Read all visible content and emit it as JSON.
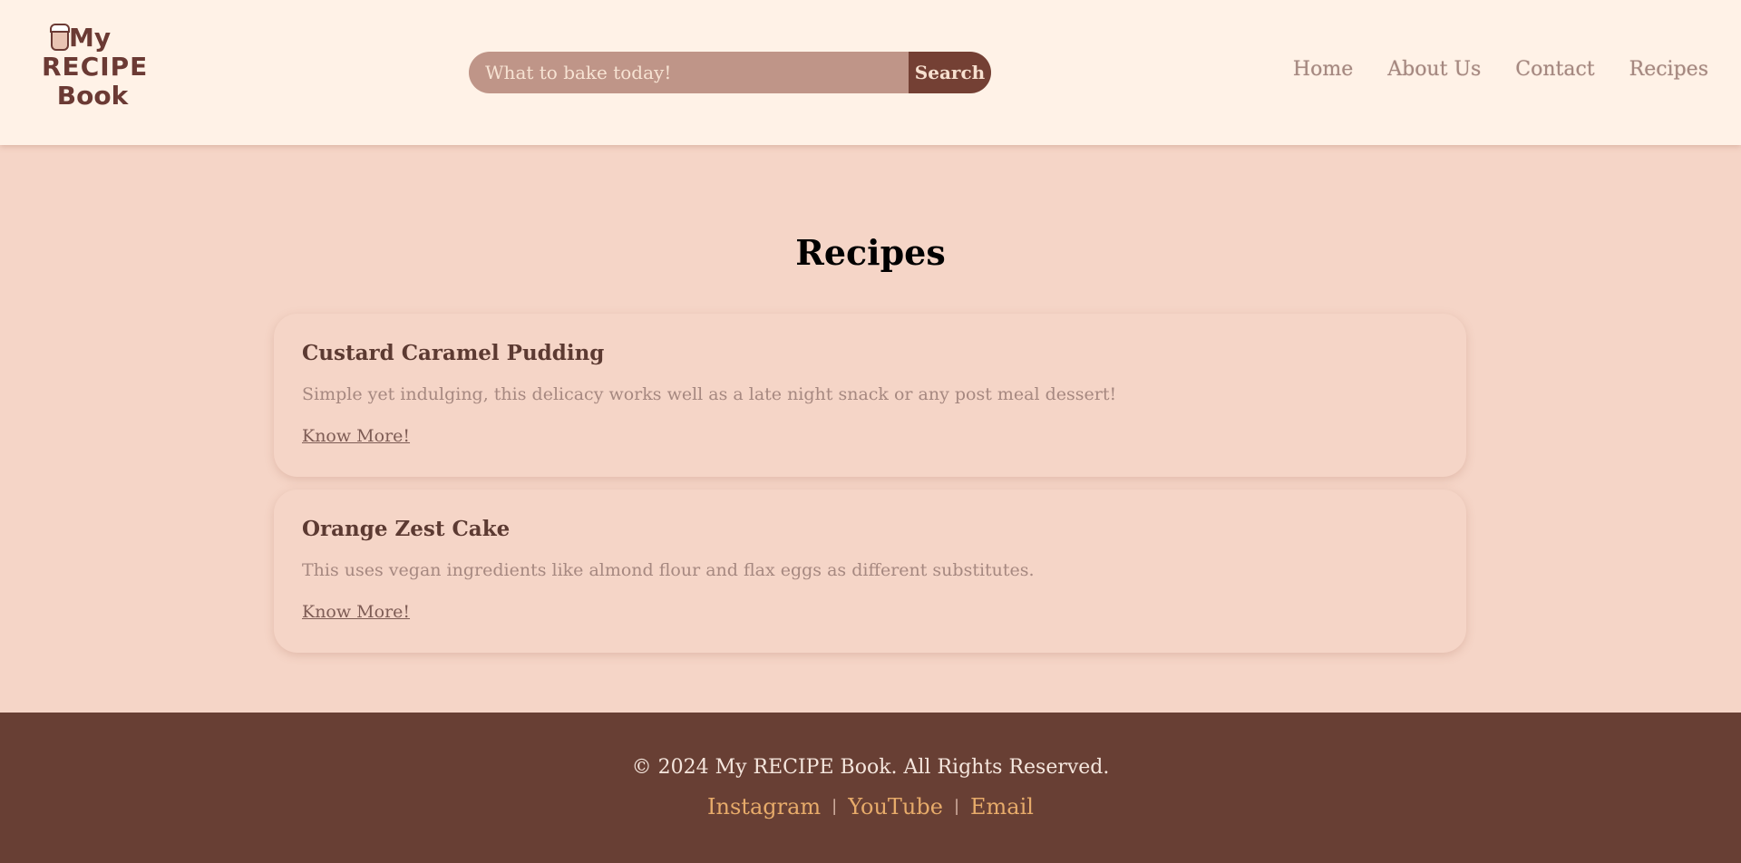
{
  "header": {
    "logo": {
      "line1": "My",
      "line2": "RECIPE",
      "line3": "Book"
    },
    "search": {
      "placeholder": "What to bake today!",
      "button_label": "Search"
    },
    "nav": [
      "Home",
      "About Us",
      "Contact",
      "Recipes"
    ]
  },
  "main": {
    "title": "Recipes",
    "recipes": [
      {
        "title": "Custard Caramel Pudding",
        "description": "Simple yet indulging, this delicacy works well as a late night snack or any post meal dessert!",
        "link_label": "Know More!"
      },
      {
        "title": "Orange Zest Cake",
        "description": "This uses vegan ingredients like almond flour and flax eggs as different substitutes.",
        "link_label": "Know More!"
      }
    ]
  },
  "footer": {
    "copyright": "© 2024 My RECIPE Book. All Rights Reserved.",
    "links": [
      "Instagram",
      "YouTube",
      "Email"
    ],
    "separator": "|"
  },
  "colors": {
    "header_bg": "#fff2e7",
    "page_bg": "#f5d5c7",
    "search_field": "#bf9588",
    "search_button": "#744034",
    "footer_bg": "#683f34",
    "footer_link": "#e7ab6a"
  },
  "icons": {
    "logo": "cupcake-logo-icon"
  }
}
